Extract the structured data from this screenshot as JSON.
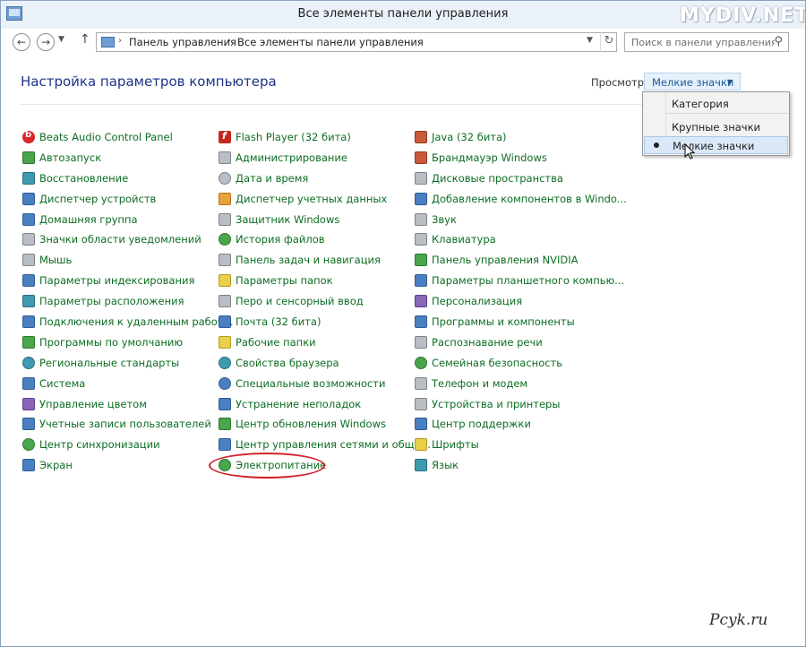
{
  "window": {
    "title": "Все элементы панели управления",
    "watermark": "MYDIV.NET"
  },
  "address": {
    "segments": [
      "Панель управления",
      "Все элементы панели управления"
    ],
    "search_placeholder": "Поиск в панели управления"
  },
  "page": {
    "heading": "Настройка параметров компьютера"
  },
  "view": {
    "label": "Просмотр:",
    "current": "Мелкие значки",
    "options": [
      {
        "label": "Категория",
        "selected": false
      },
      {
        "label": "Крупные значки",
        "selected": false
      },
      {
        "label": "Мелкие значки",
        "selected": true
      }
    ]
  },
  "items": {
    "col1": [
      {
        "label": "Beats Audio Control Panel",
        "icon": "beats-icon"
      },
      {
        "label": "Автозапуск",
        "icon": "autoplay-icon"
      },
      {
        "label": "Восстановление",
        "icon": "recovery-icon"
      },
      {
        "label": "Диспетчер устройств",
        "icon": "device-manager-icon"
      },
      {
        "label": "Домашняя группа",
        "icon": "homegroup-icon"
      },
      {
        "label": "Значки области уведомлений",
        "icon": "notification-icons-icon"
      },
      {
        "label": "Мышь",
        "icon": "mouse-icon"
      },
      {
        "label": "Параметры индексирования",
        "icon": "indexing-icon"
      },
      {
        "label": "Параметры расположения",
        "icon": "location-icon"
      },
      {
        "label": "Подключения к удаленным рабоч...",
        "icon": "remote-connection-icon"
      },
      {
        "label": "Программы по умолчанию",
        "icon": "default-programs-icon"
      },
      {
        "label": "Региональные стандарты",
        "icon": "region-icon"
      },
      {
        "label": "Система",
        "icon": "system-icon"
      },
      {
        "label": "Управление цветом",
        "icon": "color-management-icon"
      },
      {
        "label": "Учетные записи пользователей",
        "icon": "user-accounts-icon"
      },
      {
        "label": "Центр синхронизации",
        "icon": "sync-center-icon"
      },
      {
        "label": "Экран",
        "icon": "display-icon"
      }
    ],
    "col2": [
      {
        "label": "Flash Player (32 бита)",
        "icon": "flash-icon"
      },
      {
        "label": "Администрирование",
        "icon": "admin-tools-icon"
      },
      {
        "label": "Дата и время",
        "icon": "date-time-icon"
      },
      {
        "label": "Диспетчер учетных данных",
        "icon": "credential-manager-icon"
      },
      {
        "label": "Защитник Windows",
        "icon": "defender-icon"
      },
      {
        "label": "История файлов",
        "icon": "file-history-icon"
      },
      {
        "label": "Панель задач и навигация",
        "icon": "taskbar-icon"
      },
      {
        "label": "Параметры папок",
        "icon": "folder-options-icon"
      },
      {
        "label": "Перо и сенсорный ввод",
        "icon": "pen-touch-icon"
      },
      {
        "label": "Почта (32 бита)",
        "icon": "mail-icon"
      },
      {
        "label": "Рабочие папки",
        "icon": "work-folders-icon"
      },
      {
        "label": "Свойства браузера",
        "icon": "internet-options-icon"
      },
      {
        "label": "Специальные возможности",
        "icon": "ease-of-access-icon"
      },
      {
        "label": "Устранение неполадок",
        "icon": "troubleshooting-icon"
      },
      {
        "label": "Центр обновления Windows",
        "icon": "windows-update-icon"
      },
      {
        "label": "Центр управления сетями и общи...",
        "icon": "network-center-icon"
      },
      {
        "label": "Электропитание",
        "icon": "power-options-icon"
      }
    ],
    "col3": [
      {
        "label": "Java (32 бита)",
        "icon": "java-icon"
      },
      {
        "label": "Брандмауэр Windows",
        "icon": "firewall-icon"
      },
      {
        "label": "Дисковые пространства",
        "icon": "storage-spaces-icon"
      },
      {
        "label": "Добавление компонентов в Windo...",
        "icon": "add-features-icon"
      },
      {
        "label": "Звук",
        "icon": "sound-icon"
      },
      {
        "label": "Клавиатура",
        "icon": "keyboard-icon"
      },
      {
        "label": "Панель управления NVIDIA",
        "icon": "nvidia-icon"
      },
      {
        "label": "Параметры планшетного компью...",
        "icon": "tablet-settings-icon"
      },
      {
        "label": "Персонализация",
        "icon": "personalization-icon"
      },
      {
        "label": "Программы и компоненты",
        "icon": "programs-features-icon"
      },
      {
        "label": "Распознавание речи",
        "icon": "speech-recognition-icon"
      },
      {
        "label": "Семейная безопасность",
        "icon": "family-safety-icon"
      },
      {
        "label": "Телефон и модем",
        "icon": "phone-modem-icon"
      },
      {
        "label": "Устройства и принтеры",
        "icon": "devices-printers-icon"
      },
      {
        "label": "Центр поддержки",
        "icon": "action-center-icon"
      },
      {
        "label": "Шрифты",
        "icon": "fonts-icon"
      },
      {
        "label": "Язык",
        "icon": "language-icon"
      }
    ]
  },
  "colors": {
    "link": "#0c6d22",
    "heading": "#1e3287",
    "highlight": "#d2232a"
  },
  "footer": {
    "logo": "Pcyk.ru"
  }
}
